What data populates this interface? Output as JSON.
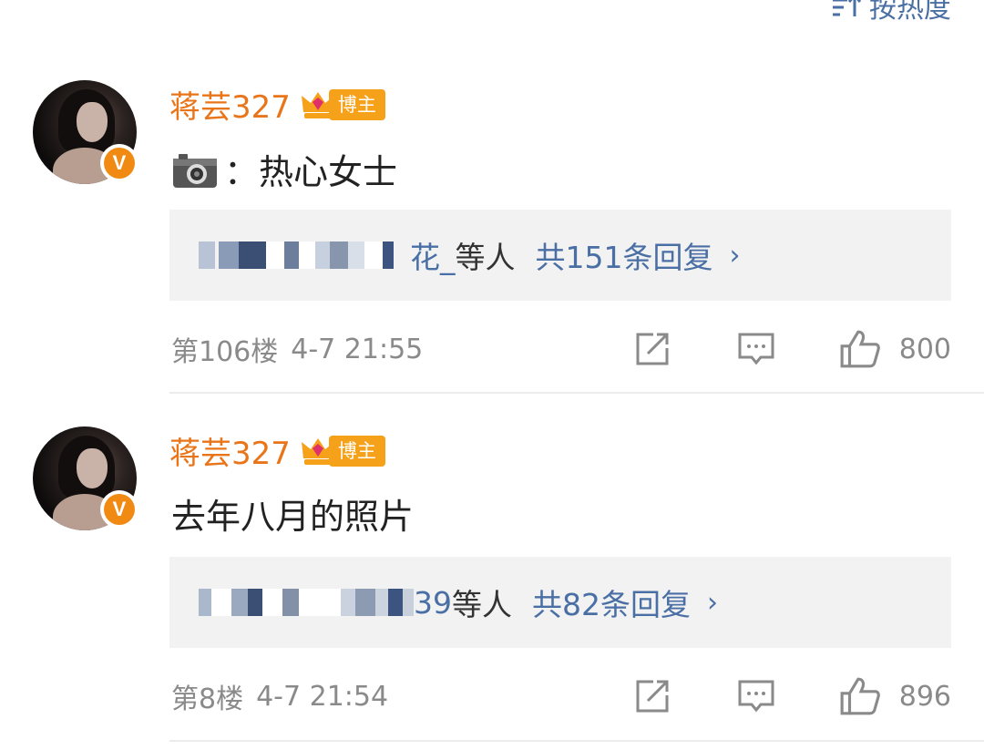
{
  "sort": {
    "label": "按热度"
  },
  "comments": [
    {
      "username": "蒋芸327",
      "badge": "博主",
      "verified_mark": "V",
      "content": "：热心女士",
      "has_camera_emoji": true,
      "reply_preview": {
        "suffix": "花_",
        "others": "等人",
        "count": "共151条回复",
        "chevron": "›"
      },
      "floor": "第106楼",
      "time": "4-7 21:55",
      "likes": "800"
    },
    {
      "username": "蒋芸327",
      "badge": "博主",
      "verified_mark": "V",
      "content": "去年八月的照片",
      "has_camera_emoji": false,
      "reply_preview": {
        "suffix": "39",
        "others": "等人",
        "count": "共82条回复",
        "chevron": "›"
      },
      "floor": "第8楼",
      "time": "4-7 21:54",
      "likes": "896"
    }
  ],
  "colors": {
    "username": "#e8751a",
    "link": "#4a6fa5",
    "meta": "#8a8a8a",
    "badge": "#f6a11a"
  }
}
